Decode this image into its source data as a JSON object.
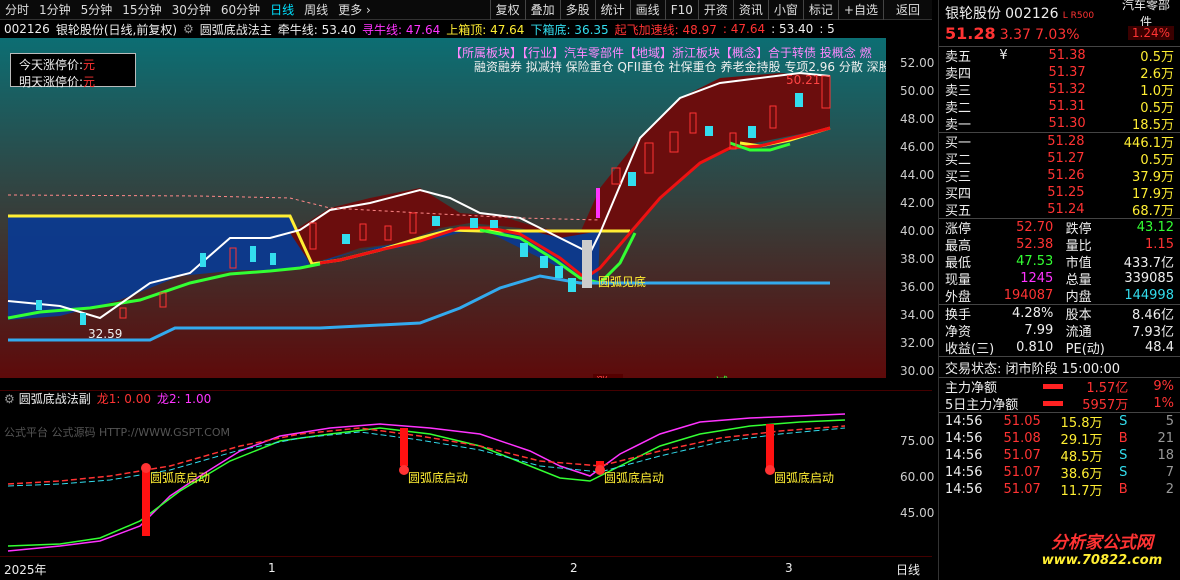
{
  "toolbar": {
    "items": [
      "分时",
      "1分钟",
      "5分钟",
      "15分钟",
      "30分钟",
      "60分钟",
      "日线",
      "周线",
      "更多 ›"
    ],
    "right": [
      "复权",
      "叠加",
      "多股",
      "统计",
      "画线",
      "F10",
      "标记",
      "自选",
      "返回"
    ],
    "right_full": [
      "复权",
      "叠加",
      "多股",
      "统计",
      "画线",
      "F10",
      "开资",
      "资讯",
      "小窗",
      "标记",
      "+自选",
      "返回"
    ]
  },
  "header": {
    "code": "002126",
    "name": "银轮股份",
    "mode": "(日线,前复权)",
    "indicator": "圆弧底战法主",
    "l1": "牵牛线: 53.40",
    "l2": "寻牛线: 47.64",
    "l3": "上箱顶: 47.64",
    "l4": "下箱底: 36.35",
    "l5": "起飞加速线: 48.97",
    "l6": ": 47.64",
    "l7": ": 53.40",
    "l8": ": 5"
  },
  "infobox": {
    "today_label": "今天涨停价:",
    "today_val": "元",
    "tomorrow_label": "明天涨停价:",
    "tomorrow_val": "元"
  },
  "tags": {
    "line1": "【所属板块】【行业】汽车零部件【地域】浙江板块【概念】合于转债 投概念 燃",
    "line2": "融资融券 拟减持 保险重仓 QFII重仓 社保重仓 养老金持股 专项2.96 分散 深股"
  },
  "chart": {
    "price_label": "50.21",
    "low_label": "32.59",
    "arc_label": "圆弧见底",
    "zhang": "涨",
    "jian": "减",
    "ticks": [
      "52.00",
      "50.00",
      "48.00",
      "46.00",
      "44.00",
      "42.00",
      "40.00",
      "38.00",
      "36.00",
      "34.00",
      "32.00",
      "30.00"
    ]
  },
  "sub": {
    "title": "圆弧底战法副",
    "long1": "龙1: 0.00",
    "long2": "龙2: 1.00",
    "watermark": "公式平台 公式源码 HTTP://WWW.GSPT.COM",
    "signal": "圆弧底启动",
    "ticks": [
      "75.00",
      "60.00",
      "45.00"
    ]
  },
  "xaxis": {
    "labels": [
      "2025年",
      "1",
      "2",
      "3"
    ],
    "right": "日线"
  },
  "quote": {
    "name": "银轮股份",
    "code": "002126",
    "badge": "L R500",
    "sector": "汽车零部件",
    "price": "51.28",
    "change": "3.37",
    "pct": "7.03%",
    "pct2": "1.24%"
  },
  "asks": [
    [
      "卖五",
      "¥",
      "51.38",
      "0.5万"
    ],
    [
      "卖四",
      "",
      "51.37",
      "2.6万"
    ],
    [
      "卖三",
      "",
      "51.32",
      "1.0万"
    ],
    [
      "卖二",
      "",
      "51.31",
      "0.5万"
    ],
    [
      "卖一",
      "",
      "51.30",
      "18.5万"
    ]
  ],
  "bids": [
    [
      "买一",
      "51.28",
      "446.1万"
    ],
    [
      "买二",
      "51.27",
      "0.5万"
    ],
    [
      "买三",
      "51.26",
      "37.9万"
    ],
    [
      "买四",
      "51.25",
      "17.9万"
    ],
    [
      "买五",
      "51.24",
      "68.7万"
    ]
  ],
  "stats": [
    [
      "涨停",
      "52.70",
      "跌停",
      "43.12"
    ],
    [
      "最高",
      "52.38",
      "量比",
      "1.15"
    ],
    [
      "最低",
      "47.53",
      "市值",
      "433.7亿"
    ],
    [
      "现量",
      "1245",
      "总量",
      "339085"
    ],
    [
      "外盘",
      "194087",
      "内盘",
      "144998"
    ]
  ],
  "stats2": [
    [
      "换手",
      "4.28%",
      "股本",
      "8.46亿"
    ],
    [
      "净资",
      "7.99",
      "流通",
      "7.93亿"
    ],
    [
      "收益(三)",
      "0.810",
      "PE(动)",
      "48.4"
    ]
  ],
  "status": "交易状态: 闭市阶段 15:00:00",
  "flows": [
    [
      "主力净额",
      "1.57亿",
      "9%"
    ],
    [
      "5日主力净额",
      "5957万",
      "1%"
    ]
  ],
  "ticks": [
    [
      "14:56",
      "51.05",
      "15.8万",
      "S",
      "5"
    ],
    [
      "14:56",
      "51.08",
      "29.1万",
      "B",
      "21"
    ],
    [
      "14:56",
      "51.07",
      "48.5万",
      "S",
      "18"
    ],
    [
      "14:56",
      "51.07",
      "38.6万",
      "S",
      "7"
    ],
    [
      "14:56",
      "51.07",
      "11.7万",
      "B",
      "2"
    ]
  ],
  "logo": {
    "title": "分析家公式网",
    "url": "www.70822.com"
  },
  "colors": {
    "up": "#ff3333",
    "down": "#33ff33",
    "cyan": "#33ddee",
    "yellow": "#ffee33",
    "magenta": "#ff33ff"
  }
}
